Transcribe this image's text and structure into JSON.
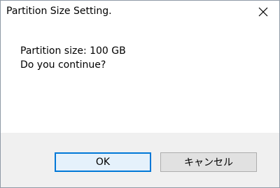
{
  "window": {
    "title": "Partition Size Setting.",
    "close_icon": "close-icon"
  },
  "message": {
    "line1": "Partition size: 100 GB",
    "line2": "Do you continue?"
  },
  "buttons": {
    "ok_label": "OK",
    "cancel_label": "キャンセル"
  },
  "colors": {
    "accent": "#0078d7",
    "footer_bg": "#f0f0f0",
    "button_bg": "#e1e1e1",
    "ok_button_bg": "#e5f1fb"
  }
}
